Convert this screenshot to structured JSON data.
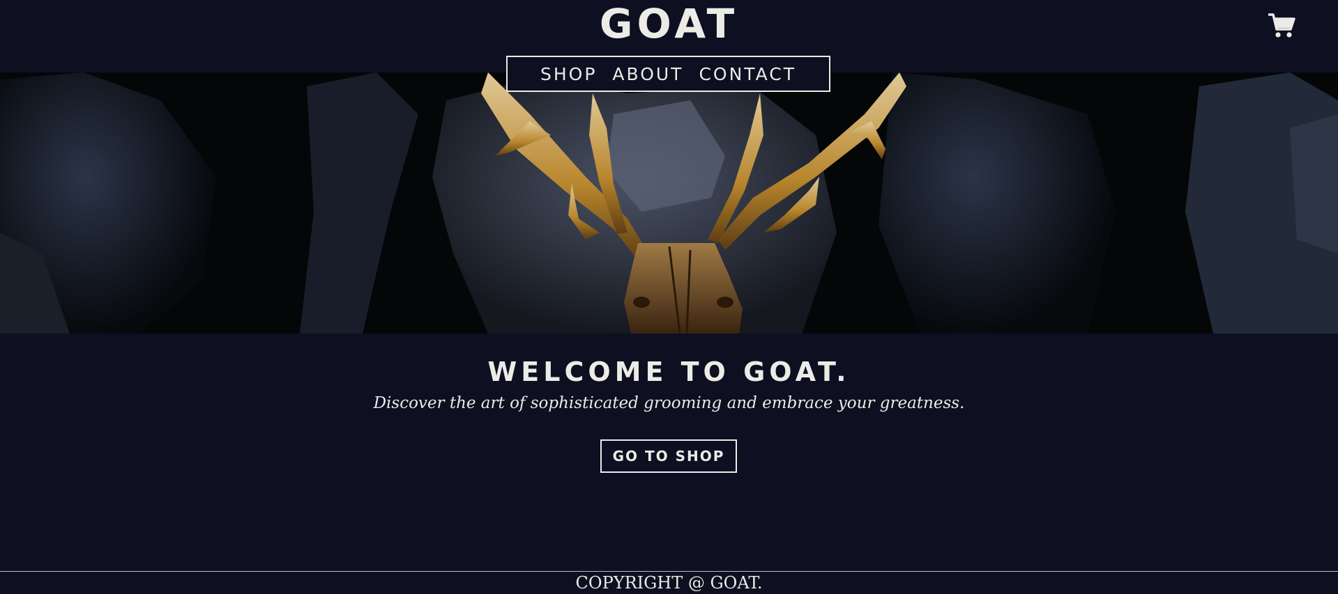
{
  "header": {
    "logo": "GOAT",
    "cart_icon": "shopping-cart-icon"
  },
  "nav": {
    "items": [
      {
        "label": "SHOP"
      },
      {
        "label": "ABOUT"
      },
      {
        "label": "CONTACT"
      }
    ]
  },
  "hero": {
    "image": "deer-skull-with-golden-antlers-on-dark-rocks"
  },
  "main": {
    "heading": "WELCOME TO GOAT.",
    "tagline": "Discover the art of sophisticated grooming and embrace your greatness.",
    "cta_label": "GO TO SHOP"
  },
  "footer": {
    "copyright": "COPYRIGHT @ GOAT."
  },
  "colors": {
    "background": "#0e0f21",
    "text": "#ecebe6",
    "antler_gold": "#b8862d"
  }
}
